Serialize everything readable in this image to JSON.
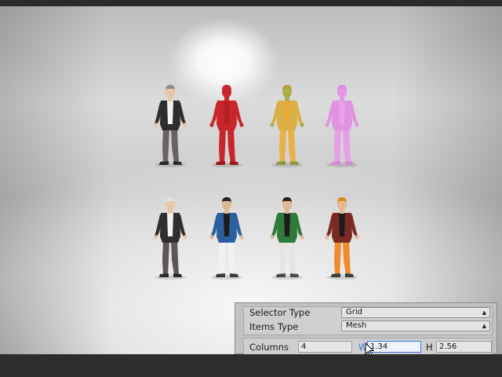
{
  "scene": {
    "characters": [
      {
        "name": "character-grey-suit",
        "colors": {
          "skin": "#e8c7a9",
          "hair": "#8c8c8c",
          "shirt": "#f2f2f2",
          "jacket": "#2e2e2e",
          "pants": "#6b6363",
          "shoes": "#2a2a2a"
        }
      },
      {
        "name": "character-red-selected",
        "colors": {
          "skin": "#c8262a",
          "hair": "#c8262a",
          "shirt": "#b51f22",
          "jacket": "#c8262a",
          "pants": "#c8262a",
          "shoes": "#a01a1c"
        }
      },
      {
        "name": "character-orange-mixed",
        "colors": {
          "skin": "#a9b04a",
          "hair": "#b5a23a",
          "shirt": "#e8a93a",
          "jacket": "#d9ae44",
          "pants": "#e9b048",
          "shoes": "#8e9a3a"
        }
      },
      {
        "name": "character-pink-highlighted",
        "colors": {
          "skin": "#e596e6",
          "hair": "#dd8de0",
          "shirt": "#e9a1ea",
          "jacket": "#e193e2",
          "pants": "#e79ee8",
          "shoes": "#d588d6"
        }
      },
      {
        "name": "character-white-hair",
        "colors": {
          "skin": "#e8c7a9",
          "hair": "#e0e0e0",
          "shirt": "#f2f2f2",
          "jacket": "#2f2f2f",
          "pants": "#5e5656",
          "shoes": "#2a2a2a"
        }
      },
      {
        "name": "character-blue-jacket",
        "colors": {
          "skin": "#e0b894",
          "hair": "#2a2420",
          "shirt": "#1c1c1c",
          "jacket": "#2c5f9e",
          "pants": "#f1f1f1",
          "shoes": "#3b3b3b"
        }
      },
      {
        "name": "character-green-jacket",
        "colors": {
          "skin": "#e0b894",
          "hair": "#2a2420",
          "shirt": "#1c1c1c",
          "jacket": "#2f7a3c",
          "pants": "#e6e6e0",
          "shoes": "#4a4a4a"
        }
      },
      {
        "name": "character-maroon-jacket",
        "colors": {
          "skin": "#e7b88f",
          "hair": "#d68a2a",
          "shirt": "#1c1c1c",
          "jacket": "#7a2a22",
          "pants": "#f08a2a",
          "shoes": "#3b3b3b"
        }
      }
    ]
  },
  "inspector": {
    "selector_type": {
      "label": "Selector Type",
      "value": "Grid"
    },
    "items_type": {
      "label": "Items Type",
      "value": "Mesh"
    },
    "columns": {
      "label": "Columns",
      "value": "4"
    },
    "width": {
      "label": "W",
      "value": "1.34"
    },
    "height": {
      "label": "H",
      "value": "2.56"
    }
  }
}
